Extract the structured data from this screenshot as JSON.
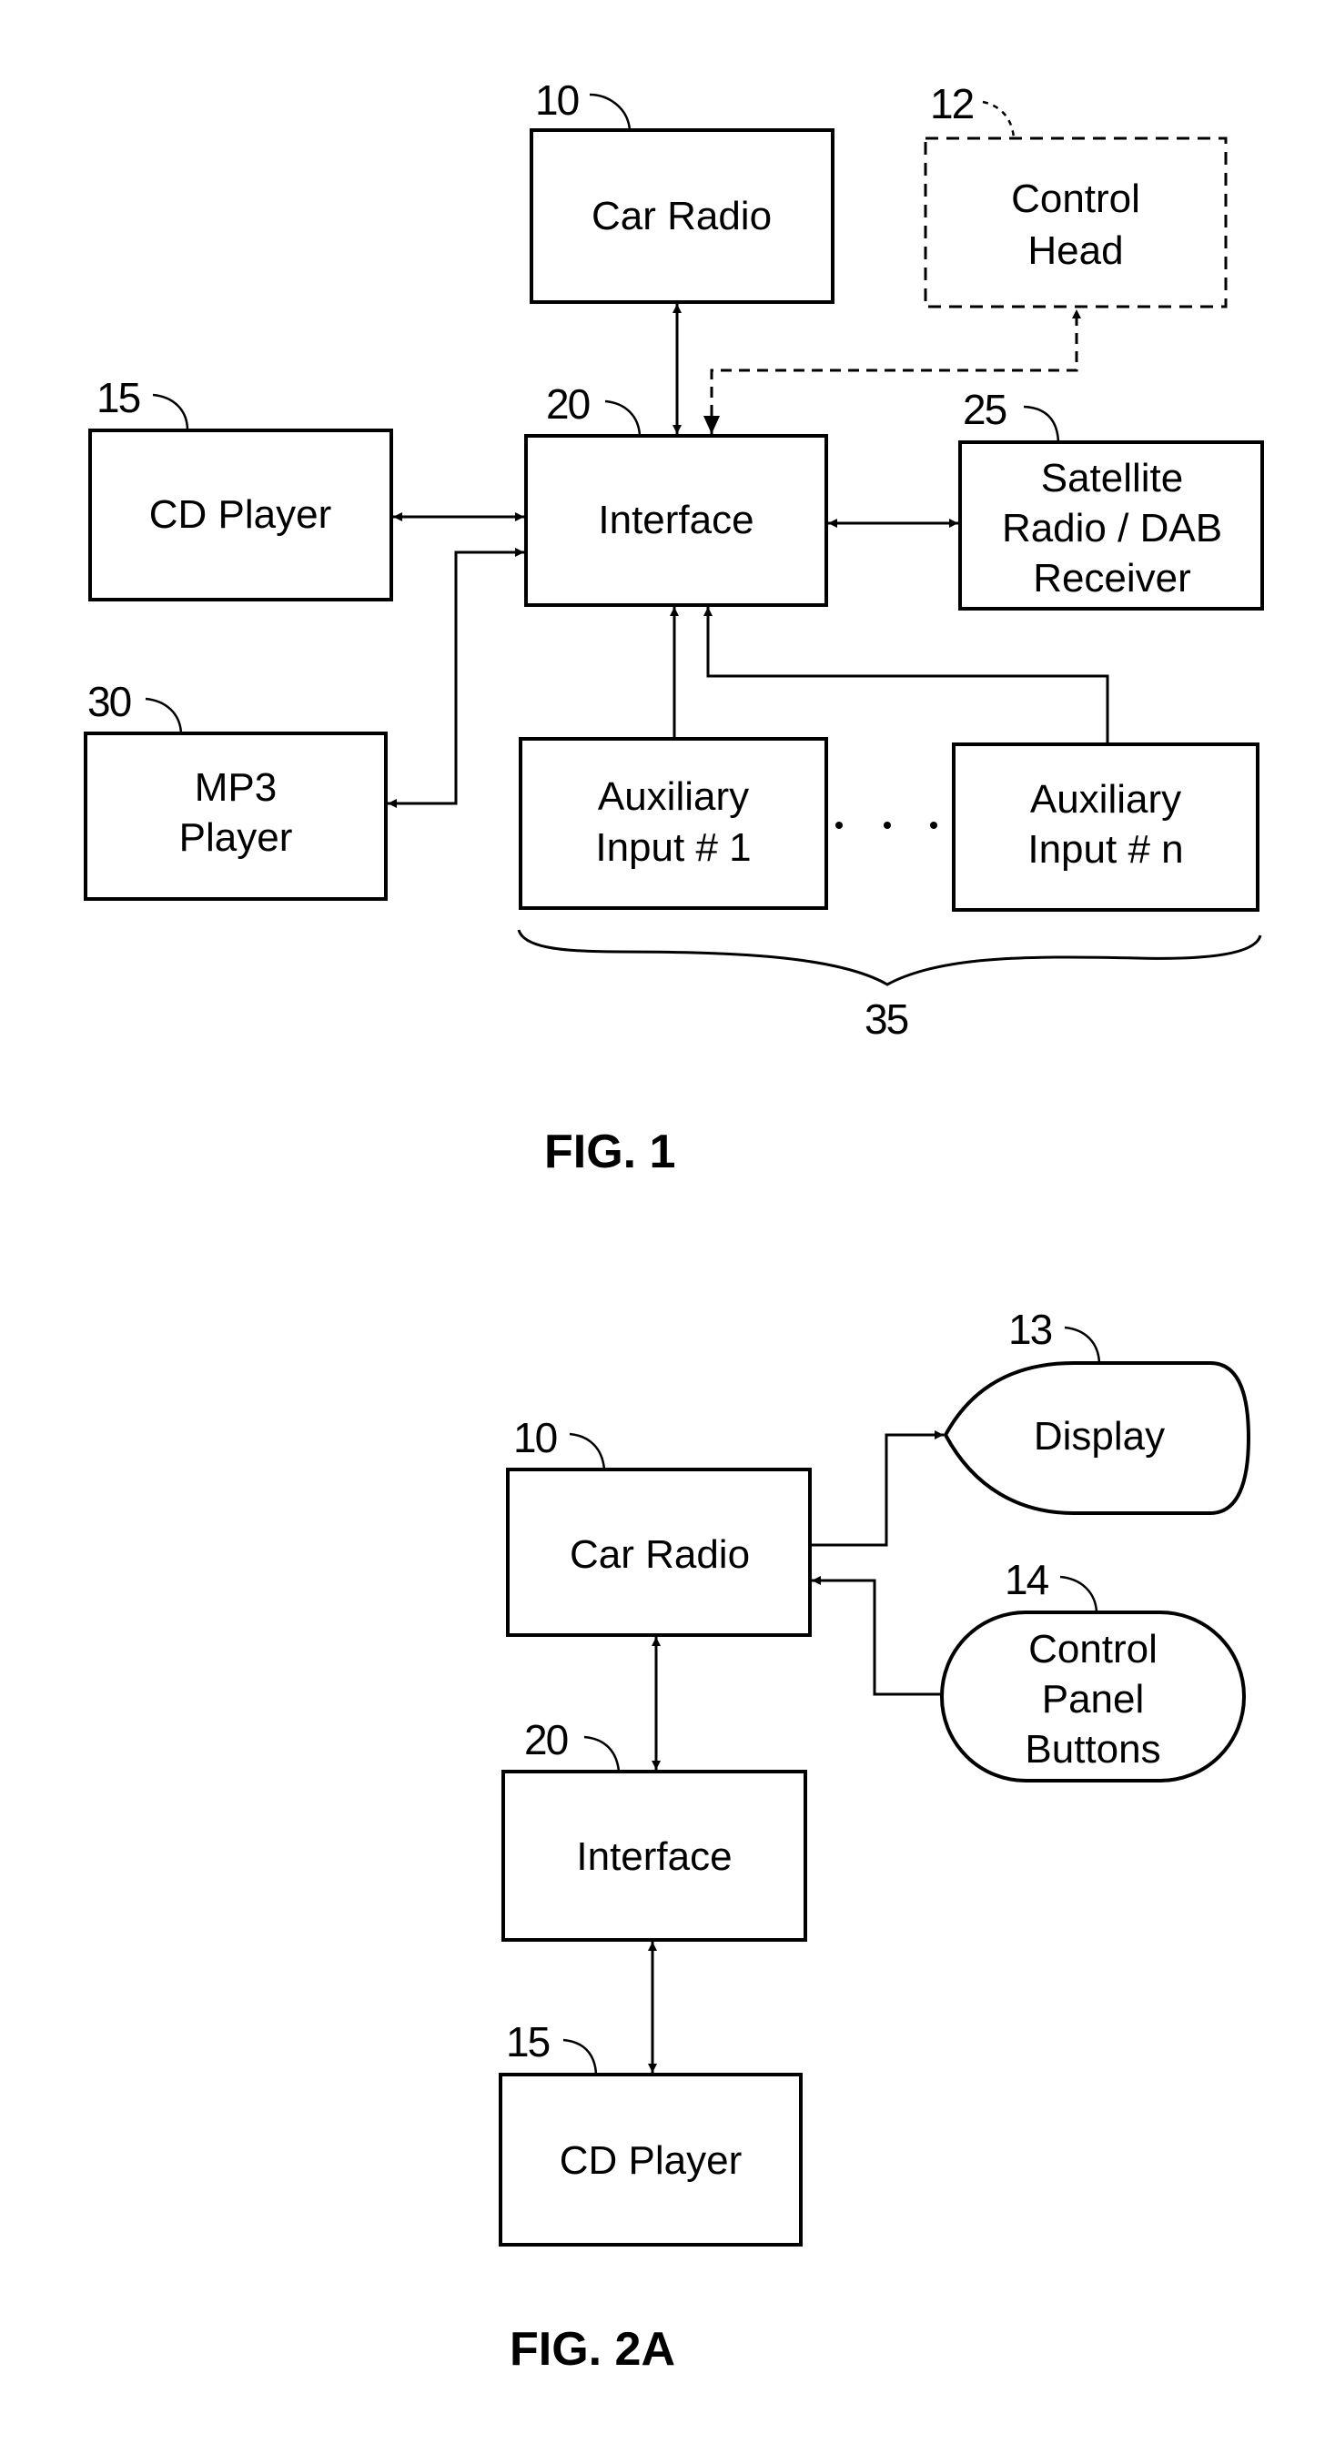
{
  "figures": [
    {
      "caption": "FIG. 1",
      "blocks": {
        "car_radio": {
          "ref": "10",
          "label": "Car Radio"
        },
        "control_head": {
          "ref": "12",
          "label": [
            "Control",
            "Head"
          ],
          "style": "dashed"
        },
        "cd_player": {
          "ref": "15",
          "label": "CD Player"
        },
        "interface": {
          "ref": "20",
          "label": "Interface"
        },
        "satellite": {
          "ref": "25",
          "label": [
            "Satellite",
            "Radio / DAB",
            "Receiver"
          ]
        },
        "mp3_player": {
          "ref": "30",
          "label": [
            "MP3",
            "Player"
          ]
        },
        "aux_1": {
          "label": [
            "Auxiliary",
            "Input # 1"
          ]
        },
        "aux_n": {
          "label": [
            "Auxiliary",
            "Input # n"
          ]
        },
        "aux_group": {
          "ref": "35"
        }
      },
      "connections": [
        {
          "from": "car_radio",
          "to": "interface",
          "type": "bidirectional"
        },
        {
          "from": "interface",
          "to": "control_head",
          "type": "dashed-unidirectional"
        },
        {
          "from": "cd_player",
          "to": "interface",
          "type": "bidirectional"
        },
        {
          "from": "mp3_player",
          "to": "interface",
          "type": "bidirectional"
        },
        {
          "from": "interface",
          "to": "satellite",
          "type": "bidirectional"
        },
        {
          "from": "aux_1",
          "to": "interface",
          "type": "unidirectional"
        },
        {
          "from": "aux_n",
          "to": "interface",
          "type": "unidirectional"
        }
      ]
    },
    {
      "caption": "FIG. 2A",
      "blocks": {
        "display": {
          "ref": "13",
          "label": "Display"
        },
        "car_radio": {
          "ref": "10",
          "label": "Car Radio"
        },
        "control_panel": {
          "ref": "14",
          "label": [
            "Control",
            "Panel",
            "Buttons"
          ]
        },
        "interface": {
          "ref": "20",
          "label": "Interface"
        },
        "cd_player": {
          "ref": "15",
          "label": "CD Player"
        }
      },
      "connections": [
        {
          "from": "car_radio",
          "to": "display",
          "type": "unidirectional"
        },
        {
          "from": "control_panel",
          "to": "car_radio",
          "type": "unidirectional"
        },
        {
          "from": "car_radio",
          "to": "interface",
          "type": "bidirectional"
        },
        {
          "from": "interface",
          "to": "cd_player",
          "type": "bidirectional"
        }
      ]
    }
  ]
}
